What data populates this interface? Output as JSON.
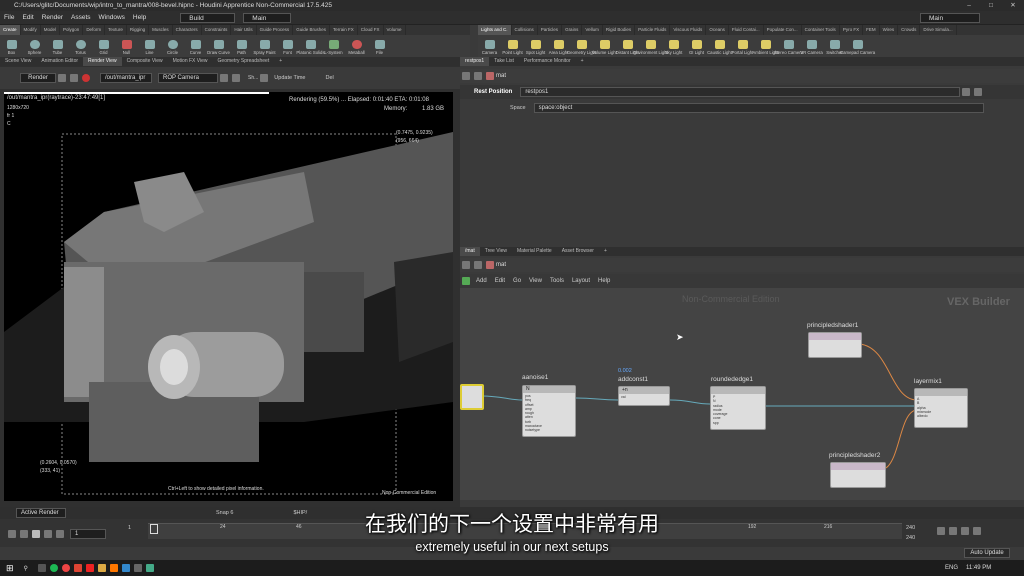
{
  "window": {
    "title": "C:/Users/glitc/Documents/wip/intro_to_mantra/008-bevel.hipnc - Houdini Apprentice Non-Commercial 17.5.425",
    "desk": "Main"
  },
  "menu": [
    "File",
    "Edit",
    "Render",
    "Assets",
    "Windows",
    "Help"
  ],
  "build_dropdown": "Build",
  "main_dropdown": "Main",
  "shelf_tabs_left": [
    "Create",
    "Modify",
    "Model",
    "Polygon",
    "Deform",
    "Texture",
    "Rigging",
    "Muscles",
    "Characters",
    "Constraints",
    "Hair Utils",
    "Guide Process",
    "Guide Brushes",
    "Terrain FX",
    "Cloud FX",
    "Volume"
  ],
  "shelf_tools_left": [
    "Box",
    "Sphere",
    "Tube",
    "Torus",
    "Grid",
    "Null",
    "Line",
    "Circle",
    "Curve",
    "Draw Curve",
    "Path",
    "Spray Paint",
    "Font",
    "Platonic Solids",
    "L-System",
    "Metaball",
    "File"
  ],
  "shelf_tabs_right": [
    "Lights and C.",
    "Collisions",
    "Particles",
    "Grains",
    "Vellum",
    "Rigid Bodies",
    "Particle Fluids",
    "Viscous Fluids",
    "Oceans",
    "Fluid Contai...",
    "Populate Con...",
    "Container Tools",
    "Pyro FX",
    "FEM",
    "Wires",
    "Crowds",
    "Drive Simula..."
  ],
  "shelf_tools_right": [
    "Camera",
    "Point Light",
    "Spot Light",
    "Area Light",
    "Geometry Light",
    "Volume Light",
    "Distant Light",
    "Environment Light",
    "Sky Light",
    "GI Light",
    "Caustic Light",
    "Portal Light",
    "Ambient Light",
    "Stereo Camera",
    "VR Camera",
    "Switcher",
    "Gamepad Camera"
  ],
  "left_tabs": [
    "Scene View",
    "Animation Editor",
    "Render View",
    "Composite View",
    "Motion FX View",
    "Geometry Spreadsheet"
  ],
  "render_toolbar": {
    "render_button": "Render",
    "rop_path": "/out/mantra_ipr",
    "camera": "ROP Camera",
    "update": "Update Time",
    "shortcut": "Sh...",
    "del": "Del"
  },
  "render_view": {
    "status_left": "/out/mantra_ipr(raytrace)-23:47:49[1]",
    "status_right": "Rendering (59.5%) ... Elapsed: 0:01:40  ETA: 0:01:08",
    "res": "1280x720",
    "fr": "fr 1",
    "channel": "C",
    "memory_label": "Memory:",
    "memory_value": "1.83 GB",
    "coord_top": "(0.7475, 0.9235)",
    "coord_top_px": "(956, 664)",
    "coord_bottom": "(0.2604, 0.0570)",
    "coord_bottom_px": "(333, 41)",
    "hint": "Ctrl+Left to show detailed pixel information.",
    "edition": "Non-Commercial Edition"
  },
  "param_tabs": [
    "restpos1",
    "Take List",
    "Performance Monitor"
  ],
  "param_path": "mat",
  "param_node": {
    "type": "Rest Position",
    "name": "restpos1",
    "space_label": "Space",
    "space_value": "space:object"
  },
  "net_tabs": [
    "/mat",
    "Tree View",
    "Material Palette",
    "Asset Browser"
  ],
  "net_path": "mat",
  "net_menu": [
    "Add",
    "Edit",
    "Go",
    "View",
    "Tools",
    "Layout",
    "Help"
  ],
  "net_watermark": "Non-Commercial Edition",
  "net_context": "VEX Builder",
  "nodes": [
    {
      "name": "aanoise1",
      "ports": [
        "pos",
        "freq",
        "offset",
        "amp",
        "rough",
        "atten",
        "turb",
        "maxoctave",
        "noisetype"
      ]
    },
    {
      "name": "addconst1",
      "value": "0.002",
      "ports": [
        "val"
      ]
    },
    {
      "name": "roundededge1",
      "ports": [
        "P",
        "N",
        "radius",
        "mode",
        "coverage",
        "cone",
        "spp"
      ]
    },
    {
      "name": "principledshader1",
      "ports": []
    },
    {
      "name": "principledshader2",
      "ports": []
    },
    {
      "name": "layermix1",
      "ports": [
        "A",
        "B",
        "alpha",
        "mixmode",
        "albedo"
      ]
    }
  ],
  "timeline": {
    "frame": "1",
    "start": "1",
    "end_a": "240",
    "end_b": "240",
    "ticks": [
      "24",
      "46",
      "192",
      "216"
    ],
    "active_render": "Active Render",
    "snap": "Snap 6",
    "ship": "$HIP/",
    "auto_update": "Auto Update"
  },
  "subtitle_cn": "在我们的下一个设置中非常有用",
  "subtitle_en": "extremely useful in our next setups",
  "taskbar": {
    "lang": "ENG",
    "time": "11:49 PM"
  }
}
